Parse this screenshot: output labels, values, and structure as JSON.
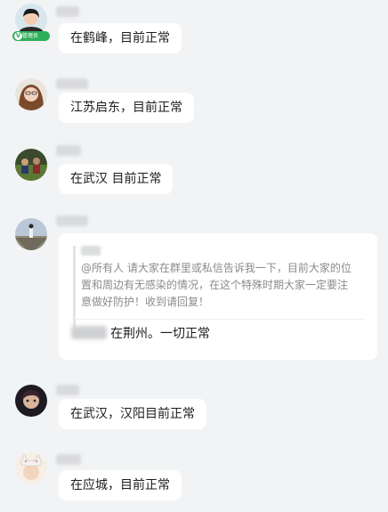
{
  "messages": [
    {
      "text": "在鹤峰，目前正常",
      "badge": "管理员"
    },
    {
      "text": "江苏启东，目前正常"
    },
    {
      "text": "在武汉 目前正常"
    },
    {
      "quote": "@所有人 请大家在群里或私信告诉我一下，目前大家的位置和周边有无感染的情况，在这个特殊时期大家一定要注意做好防护！收到请回复！",
      "reply": "在荆州。一切正常"
    },
    {
      "text": "在武汉，汉阳目前正常"
    },
    {
      "text": "在应城，目前正常"
    }
  ],
  "colors": {
    "background": "#f2f3f5",
    "bubble": "#ffffff",
    "badge": "#2eae5a",
    "quote_text": "#8a8b8e"
  }
}
